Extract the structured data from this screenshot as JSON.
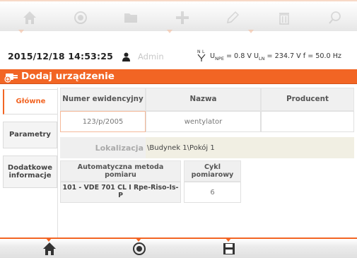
{
  "toolbar": {
    "icons": [
      "home-icon",
      "record-icon",
      "folder-icon",
      "add-icon",
      "edit-icon",
      "delete-icon",
      "search-icon"
    ]
  },
  "status": {
    "datetime": "2015/12/18 14:53:25",
    "user": "Admin",
    "unpe_label": "U",
    "unpe_sub": "NPE",
    "unpe_value": " = 0.8 V ",
    "uln_label": "U",
    "uln_sub": "LN",
    "uln_value": " = 234.7 V ",
    "freq": "f = 50.0 Hz",
    "plug_label": "N L"
  },
  "title": "Dodaj urządzenie",
  "tabs": [
    {
      "label": "Główne",
      "active": true
    },
    {
      "label": "Parametry",
      "active": false
    },
    {
      "label": "Dodatkowe informacje",
      "active": false
    }
  ],
  "table": {
    "headers": {
      "id": "Numer ewidencyjny",
      "name": "Nazwa",
      "producer": "Producent"
    },
    "values": {
      "id": "123/p/2005",
      "name": "wentylator",
      "producer": ""
    },
    "location_label": "Lokalizacja",
    "location_value": "\\Budynek 1\\Pokój 1",
    "method_header": "Automatyczna metoda pomiaru",
    "cycle_header": "Cykl pomiarowy",
    "method_value": "101 - VDE 701 CL I Rpe-Riso-Is-P",
    "cycle_value": "6"
  },
  "bottom": {
    "buttons": [
      "home-icon",
      "record-icon",
      "save-icon"
    ]
  },
  "colors": {
    "accent": "#f26524",
    "location_bg": "#f1efe3"
  }
}
